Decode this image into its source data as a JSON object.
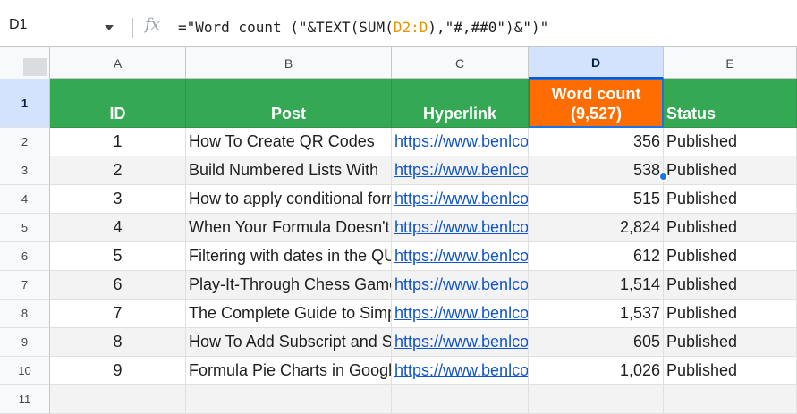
{
  "formula_bar": {
    "name_box": "D1",
    "fx_label": "fx",
    "formula_prefix": "=\"Word count (\"&TEXT(SUM(",
    "formula_ref": "D2:D",
    "formula_suffix": "),\"#,##0\")&\")\""
  },
  "columns": [
    "A",
    "B",
    "C",
    "D",
    "E"
  ],
  "selected_column": "D",
  "row_numbers": [
    "1",
    "2",
    "3",
    "4",
    "5",
    "6",
    "7",
    "8",
    "9",
    "10",
    "11"
  ],
  "header": {
    "id": "ID",
    "post": "Post",
    "hyperlink": "Hyperlink",
    "word_count_line1": "Word count",
    "word_count_line2": "(9,527)",
    "status": "Status"
  },
  "rows": [
    {
      "id": "1",
      "post": "How To Create QR Codes",
      "link": "https://www.benlcollins.com",
      "words": "356",
      "status": "Published"
    },
    {
      "id": "2",
      "post": "Build Numbered Lists With",
      "link": "https://www.benlcollins.com",
      "words": "538",
      "status": "Published"
    },
    {
      "id": "3",
      "post": "How to apply conditional formatting",
      "link": "https://www.benlcollins.com",
      "words": "515",
      "status": "Published"
    },
    {
      "id": "4",
      "post": "When Your Formula Doesn't Work",
      "link": "https://www.benlcollins.com",
      "words": "2,824",
      "status": "Published"
    },
    {
      "id": "5",
      "post": "Filtering with dates in the QUERY",
      "link": "https://www.benlcollins.com",
      "words": "612",
      "status": "Published"
    },
    {
      "id": "6",
      "post": "Play-It-Through Chess Game",
      "link": "https://www.benlcollins.com",
      "words": "1,514",
      "status": "Published"
    },
    {
      "id": "7",
      "post": "The Complete Guide to Simple",
      "link": "https://www.benlcollins.com",
      "words": "1,537",
      "status": "Published"
    },
    {
      "id": "8",
      "post": "How To Add Subscript and Superscript",
      "link": "https://www.benlcollins.com",
      "words": "605",
      "status": "Published"
    },
    {
      "id": "9",
      "post": "Formula Pie Charts in Google Sheets",
      "link": "https://www.benlcollins.com",
      "words": "1,026",
      "status": "Published"
    }
  ],
  "colors": {
    "header_green": "#34a853",
    "highlight_orange": "#ff6d01",
    "selection_blue": "#1a73e8",
    "link_blue": "#1155cc"
  }
}
